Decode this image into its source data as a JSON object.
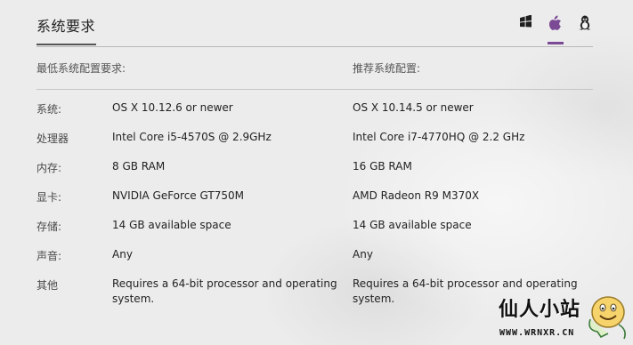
{
  "section_title": "系统要求",
  "os_tabs": [
    {
      "name": "windows",
      "icon": "windows-icon",
      "active": false
    },
    {
      "name": "mac",
      "icon": "apple-icon",
      "active": true
    },
    {
      "name": "linux",
      "icon": "linux-icon",
      "active": false
    }
  ],
  "accent_color": "#7a4a94",
  "columns": {
    "minimum": "最低系统配置要求:",
    "recommended": "推荐系统配置:"
  },
  "rows": [
    {
      "label": "系统:",
      "minimum": "OS X 10.12.6 or newer",
      "recommended": "OS X 10.14.5 or newer"
    },
    {
      "label": "处理器",
      "minimum": "Intel Core i5-4570S @ 2.9GHz",
      "recommended": "Intel Core i7-4770HQ @ 2.2 GHz"
    },
    {
      "label": "内存:",
      "minimum": "8 GB RAM",
      "recommended": "16 GB RAM"
    },
    {
      "label": "显卡:",
      "minimum": "NVIDIA GeForce GT750M",
      "recommended": "AMD Radeon R9 M370X"
    },
    {
      "label": "存储:",
      "minimum": "14 GB available space",
      "recommended": "14 GB available space"
    },
    {
      "label": "声音:",
      "minimum": "Any",
      "recommended": "Any"
    },
    {
      "label": "其他",
      "minimum": "Requires a 64-bit processor and operating system.",
      "recommended": "Requires a 64-bit processor and operating system."
    }
  ],
  "watermark": {
    "title": "仙人小站",
    "url": "WWW.WRNXR.CN"
  }
}
